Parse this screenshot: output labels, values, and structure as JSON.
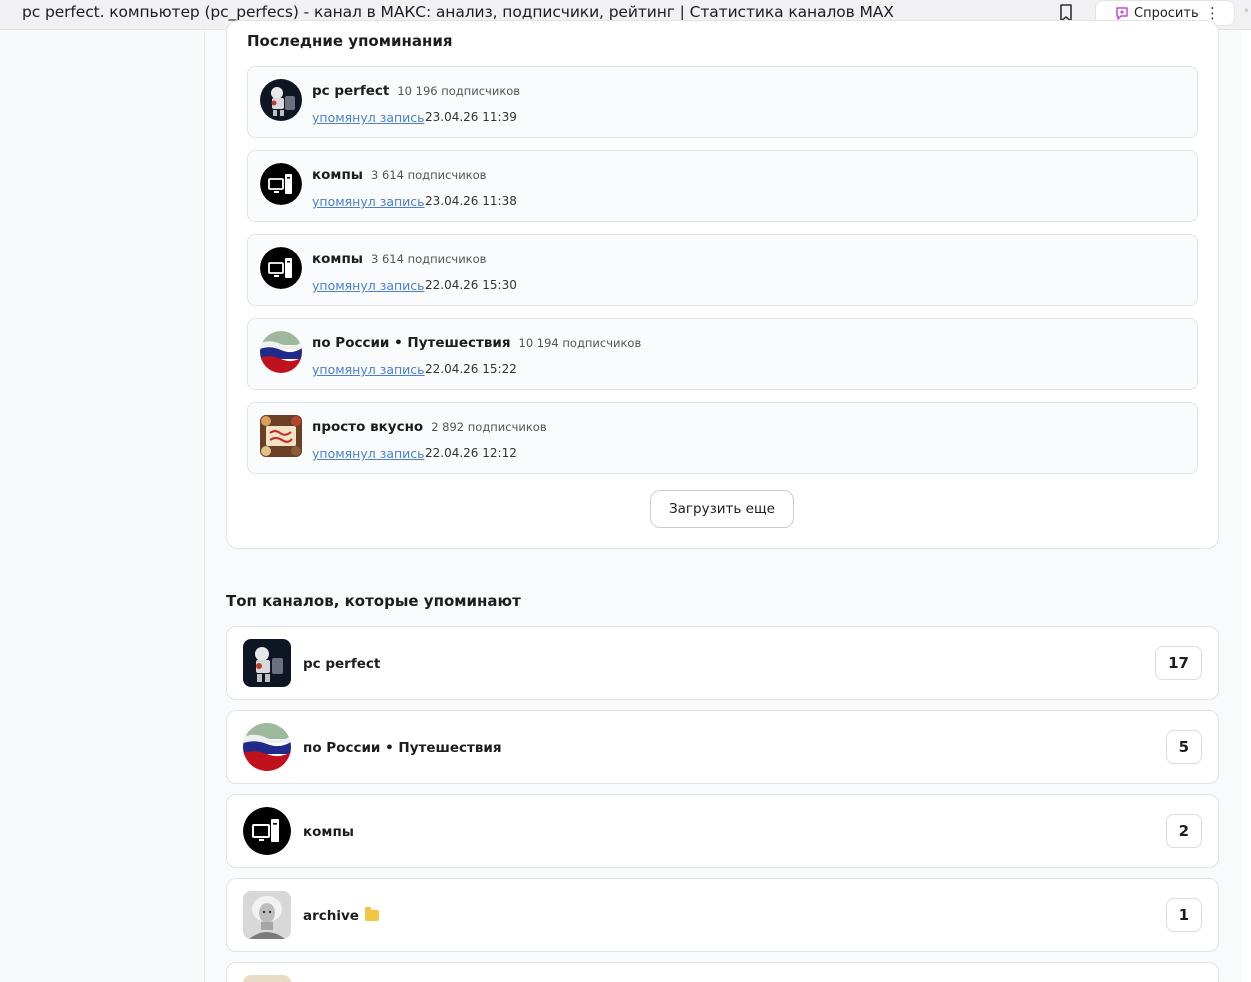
{
  "browser": {
    "tab_title": "pc perfect. компьютер (pc_perfecs) - канал в МАКС: анализ, подписчики, рейтинг | Статистика каналов MAX",
    "ask_label": "Спросить",
    "menu_glyph": "⋮"
  },
  "mentions": {
    "title": "Последние упоминания",
    "items": [
      {
        "name": "pc perfect",
        "subscribers": "10 196 подписчиков",
        "action": "упомянул запись",
        "date": "23.04.26 11:39",
        "avatar": "robot-avatar"
      },
      {
        "name": "компы",
        "subscribers": "3 614 подписчиков",
        "action": "упомянул запись",
        "date": "23.04.26 11:38",
        "avatar": "computer-avatar"
      },
      {
        "name": "компы",
        "subscribers": "3 614 подписчиков",
        "action": "упомянул запись",
        "date": "22.04.26 15:30",
        "avatar": "computer-avatar"
      },
      {
        "name": "по России • Путешествия",
        "subscribers": "10 194 подписчиков",
        "action": "упомянул запись",
        "date": "22.04.26 15:22",
        "avatar": "flag-avatar"
      },
      {
        "name": "просто вкусно",
        "subscribers": "2 892 подписчиков",
        "action": "упомянул запись",
        "date": "22.04.26 12:12",
        "avatar": "food-avatar"
      }
    ],
    "load_more": "Загрузить еще"
  },
  "top_channels": {
    "title": "Топ каналов, которые упоминают",
    "items": [
      {
        "name": "pc perfect",
        "count": "17",
        "avatar": "robot-avatar"
      },
      {
        "name": "по России • Путешествия",
        "count": "5",
        "avatar": "flag-avatar"
      },
      {
        "name": "компы",
        "count": "2",
        "avatar": "computer-avatar"
      },
      {
        "name": "archive",
        "count": "1",
        "avatar": "portrait-avatar",
        "icon": "folder-icon"
      }
    ]
  },
  "colors": {
    "link": "#4a7fd4",
    "card_border": "#e1e3e8",
    "page_bg": "#f9fafc"
  }
}
